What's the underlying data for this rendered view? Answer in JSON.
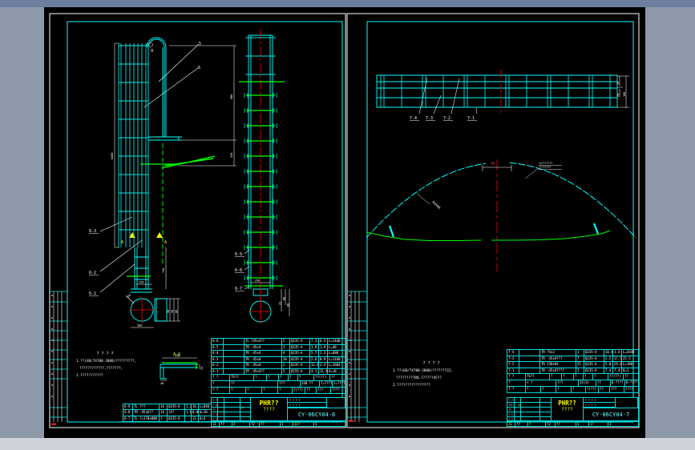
{
  "window": {
    "title_bar_color": "#6d7f9f",
    "desktop_color": "#8d98a9",
    "bottom_strip_color": "#ced3da",
    "paper_color": "#000000"
  },
  "palette": {
    "cyan": "#00ffff",
    "green": "#00ff00",
    "red": "#ff0000",
    "white": "#ffffff",
    "yellow": "#ffff00"
  },
  "sheet_left": {
    "labels": {
      "leader_5": "5",
      "leader_6": "6",
      "item_6_3": "6-3",
      "item_6_2": "6-2",
      "item_6_1": "6-1",
      "item_6_9": "6-9",
      "item_6_8": "6-8",
      "item_6_7": "6-7",
      "section_marker": "A",
      "section_title": "A-A"
    },
    "dims": {
      "cage_height": "6480",
      "hoop_height": "900",
      "bracket": "350",
      "hoop_dia": "60",
      "lower_run": "750",
      "base": "250",
      "flange_width": "500",
      "stack1": "50",
      "stack2": "58",
      "stack3": "60",
      "side_bottom": "290",
      "sstack1": "25",
      "sstack2": "60",
      "sstack3": "68",
      "flange_leader": "?40",
      "aa_width": "250",
      "aa_leg": "40",
      "aa_lip": "25"
    },
    "notes": {
      "title": "? ? ? ?",
      "line1": "1.??(GB/T4708-2000)?????????,",
      "line2": "????????????,???????,",
      "line3": "2.???????????"
    },
    "bom": {
      "rows": [
        [
          "6-6",
          "",
          "TL ?45x4??",
          "2",
          "Q235-A",
          "7.3",
          "6.4",
          "L=2440"
        ],
        [
          "6-5",
          "",
          "TR -45x4",
          "1",
          "Q235-A",
          "1.9",
          "1.9",
          "L=40"
        ],
        [
          "6-4",
          "",
          "TR -45x4",
          "4",
          "Q235-A",
          "5.7",
          "2.3",
          "L=680"
        ],
        [
          "6-3",
          "",
          "TR -45x4",
          "14",
          "Q235-A",
          "2.6",
          "0.9",
          "L=1160"
        ],
        [
          "6-2",
          "",
          "TR -45x4",
          "2",
          "Q235-A",
          "11.8",
          "2.4",
          "L=1664"
        ],
        [
          "6-1",
          "",
          "TP -45x4??",
          "2",
          "Q155-A",
          "4.1",
          "11.4",
          "d=10"
        ]
      ],
      "header1": [
        "? ?",
        "TS??",
        "?",
        "?",
        "?",
        "?",
        "?",
        "??(??)",
        "??"
      ],
      "header2": [
        "?",
        "??",
        "???",
        "240 ??",
        "?=????",
        "?=????"
      ],
      "header3": [
        "? ?",
        "?",
        "?",
        "?",
        "?",
        "?(??)",
        "??",
        "???",
        "????"
      ]
    },
    "mini_bom": [
      [
        "6-9",
        "TL ???",
        "14",
        "Q235-A",
        "1.2",
        "16.3",
        "L=640"
      ],
      [
        "6-8",
        "TR -45x6??",
        "14",
        "?4?",
        "1.8",
        "0.0",
        "d=10"
      ],
      [
        "6-7",
        "TL ?=170x800",
        "1",
        "Q235-A",
        "",
        "11.4",
        "d=4"
      ]
    ],
    "title_block": {
      "project": "PHR??",
      "subtitle": "????",
      "drawing_no": "CY-06CY04-6",
      "rev_mark": "??",
      "rev_rows": [
        "? ?",
        "? 2",
        "??",
        "1 1",
        "? ?"
      ],
      "right_marks": [
        "? ? ? ?",
        "? ? ? ?"
      ],
      "bottom_cells": [
        [
          "11",
          "??",
          "3",
          "?2",
          "7?",
          "1",
          "11?",
          "1"
        ]
      ]
    }
  },
  "sheet_right": {
    "labels": {
      "item_7_4": "7-4",
      "item_7_3": "7-3",
      "item_7_2": "7-2",
      "item_7_1": "7-1",
      "apex_dim": "M?",
      "apex_note1": "?x???????",
      "apex_note2": "????????",
      "radius": "R4500"
    },
    "dims": {
      "stack_a": "50",
      "stack_b": "24",
      "stack_all": "100"
    },
    "notes": {
      "title": "? ? ? ?",
      "line1": "1.??(GB/T4708-2000)???????22,",
      "line2": "?????????88,??????45??",
      "line3": "2.????????????????"
    },
    "bom": {
      "rows": [
        [
          "7-4",
          "",
          "TR ?5x2",
          "1",
          "Q235-A",
          "10.4",
          "1.4",
          "L=2640"
        ],
        [
          "7-3",
          "",
          "TR -45x4???",
          "7",
          "Q235-A",
          "2.5",
          "17.5",
          "25.5"
        ],
        [
          "7-2",
          "",
          "TR 150x94",
          "25",
          "Q235-A",
          "5.0",
          "24.6",
          "L=180"
        ],
        [
          "7-1",
          "",
          "TR -45x4????",
          "1",
          "Q235-A",
          "7.4",
          "7.4",
          "8=1"
        ]
      ],
      "header1": [
        "? ?",
        "TS??",
        "?",
        "?",
        "?",
        "?",
        "?",
        "??(??)",
        "??"
      ],
      "header2": [
        "?",
        "+ ?",
        "???",
        "15(3)",
        "??",
        "D-????",
        "D-????"
      ],
      "header3": [
        "? ?",
        "?",
        "?",
        "?",
        "?",
        "?(??)",
        "??",
        "???",
        "????"
      ]
    },
    "title_block": {
      "project": "PHR??",
      "subtitle": "????",
      "drawing_no": "CY-06CY04-7",
      "rev_mark": "3%",
      "rev_rows": [
        "? ?",
        "?2?",
        "??",
        "1 1",
        "? ?"
      ],
      "right_marks": [
        "? ? ? ?",
        "? ? ? ?"
      ],
      "bottom_cells": [
        [
          "11",
          "??",
          "?",
          "?2",
          "??",
          "1",
          "1?",
          "1"
        ]
      ]
    }
  }
}
